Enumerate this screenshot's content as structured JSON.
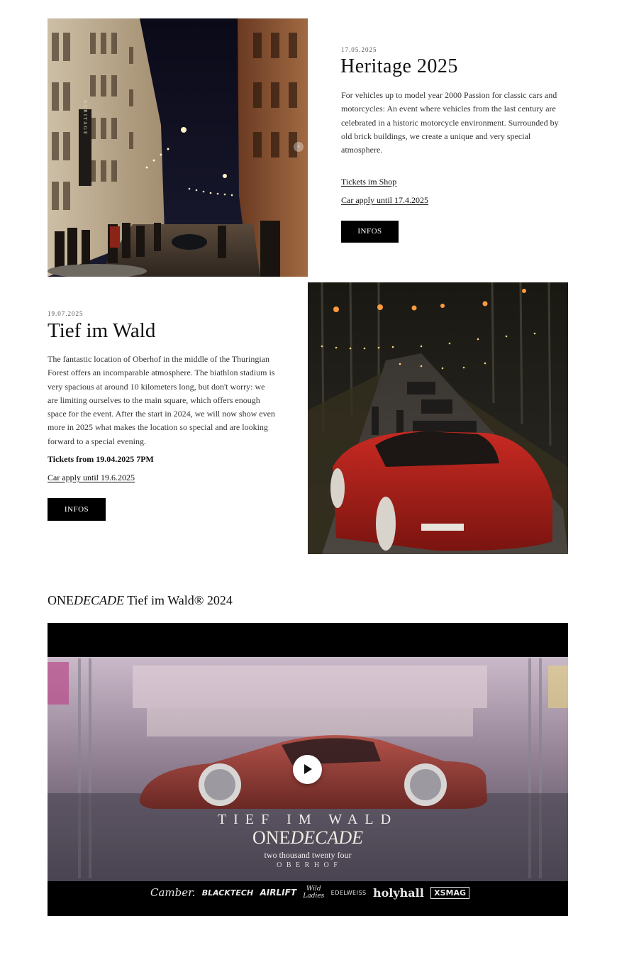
{
  "events": [
    {
      "date": "17.05.2025",
      "title": "Heritage 2025",
      "description": "For vehicles up to model year 2000 Passion for classic cars and motorcycles: An event where vehicles from the last century are celebrated in a historic motorcycle environment. Surrounded by old brick buildings, we create a unique and very special atmosphere.",
      "link_1": "Tickets im Shop",
      "link_2": "Car apply until 17.4.2025",
      "button": "INFOS",
      "image_banner_text": "HERITAGE"
    },
    {
      "date": "19.07.2025",
      "title": "Tief im Wald",
      "description": "The fantastic location of Oberhof in the middle of the Thuringian Forest offers an incomparable atmosphere. The biathlon stadium is very spacious at around 10 kilometers long, but don't worry: we are limiting ourselves to the main square, which offers enough space for the event. After the start in 2024, we will now show even more in 2025 what makes the location so special and are looking forward to a special evening.",
      "tickets_text": "Tickets from 19.04.2025 7PM",
      "link_2": "Car apply until 19.6.2025",
      "button": "INFOS"
    }
  ],
  "video_section": {
    "title_prefix": "ONE",
    "title_italic": "DECADE",
    "title_suffix": " Tief im Wald® 2024",
    "overlay": {
      "line1": "TIEF IM WALD",
      "line2_a": "ONE",
      "line2_b": "DECADE",
      "line3": "two thousand twenty four",
      "line4": "O B E R H O F"
    },
    "sponsors": [
      "Camber.",
      "BLACKTECH",
      "AIRLIFT",
      "Wild Ladies",
      "EDELWEISS",
      "holyhall",
      "XSMAG"
    ]
  }
}
